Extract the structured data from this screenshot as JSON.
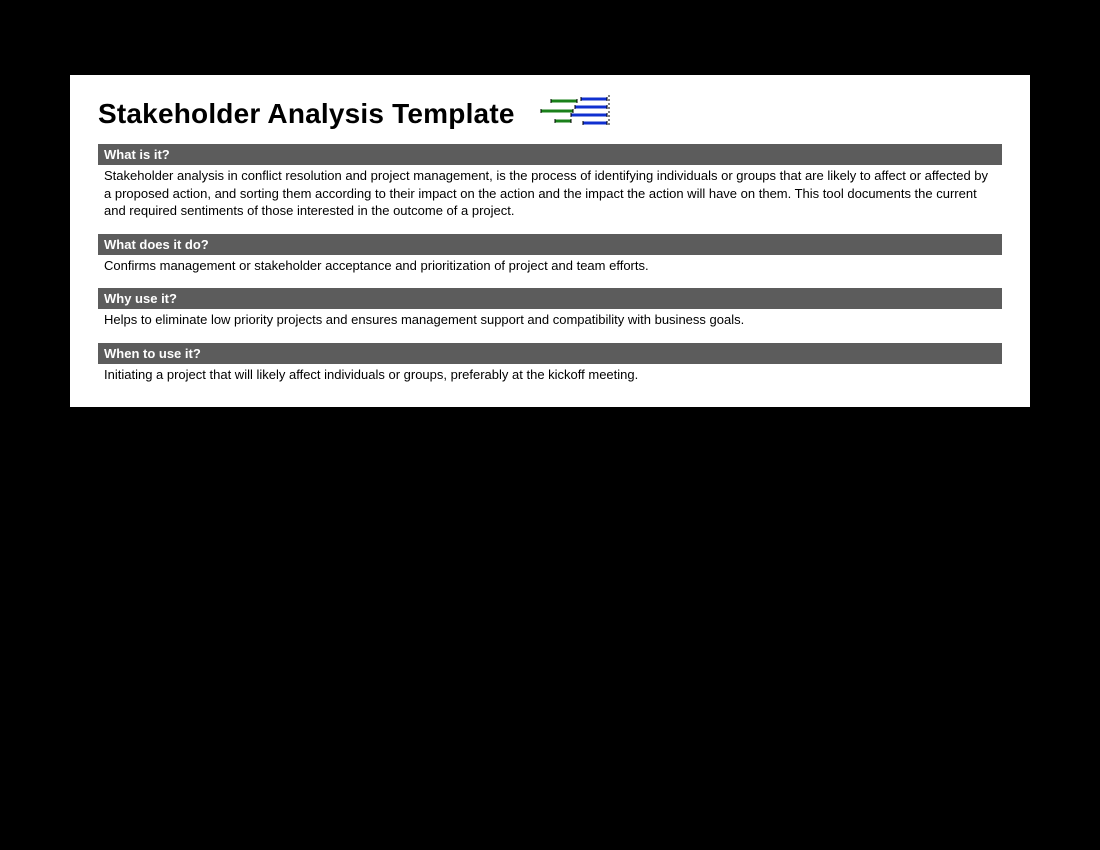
{
  "title": "Stakeholder Analysis Template",
  "sections": [
    {
      "header": "What is it?",
      "body": "Stakeholder analysis in conflict resolution and project management, is the process of identifying individuals or groups that are likely to affect or affected by a proposed action, and sorting them according to their impact on the action and the impact the action will have on them. This tool documents the current and required sentiments of those interested in the outcome of a project."
    },
    {
      "header": "What does it do?",
      "body": "Confirms management or stakeholder acceptance and prioritization of project and team efforts."
    },
    {
      "header": "Why use it?",
      "body": "Helps to eliminate low priority projects and ensures management support and compatibility with business goals."
    },
    {
      "header": "When to use it?",
      "body": "Initiating a project that will likely affect individuals or groups, preferably at the kickoff meeting."
    }
  ]
}
